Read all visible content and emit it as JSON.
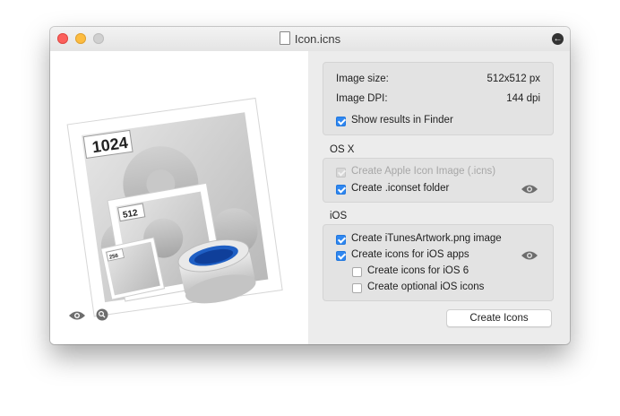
{
  "window": {
    "title": "Icon.icns"
  },
  "preview": {
    "badges": {
      "large": "1024",
      "medium": "512",
      "small": "256"
    },
    "footer_icons": [
      "eye-icon",
      "magnifier-icon"
    ]
  },
  "info": {
    "image_size_label": "Image size:",
    "image_size_value": "512x512 px",
    "image_dpi_label": "Image DPI:",
    "image_dpi_value": "144 dpi",
    "show_results": {
      "label": "Show results in Finder",
      "checked": true
    }
  },
  "osx": {
    "section_title": "OS X",
    "options": [
      {
        "label": "Create Apple Icon Image (.icns)",
        "checked": true,
        "disabled": true
      },
      {
        "label": "Create .iconset folder",
        "checked": true,
        "disabled": false
      }
    ]
  },
  "ios": {
    "section_title": "iOS",
    "options": [
      {
        "label": "Create iTunesArtwork.png image",
        "checked": true
      },
      {
        "label": "Create icons for iOS apps",
        "checked": true
      },
      {
        "label": "Create icons for iOS 6",
        "checked": false
      },
      {
        "label": "Create optional iOS icons",
        "checked": false
      }
    ]
  },
  "actions": {
    "create_label": "Create Icons"
  },
  "colors": {
    "accent": "#2f87f0",
    "close": "#fc605c",
    "minimize": "#fdbc40",
    "tape_blue": "#1f5fc4"
  }
}
